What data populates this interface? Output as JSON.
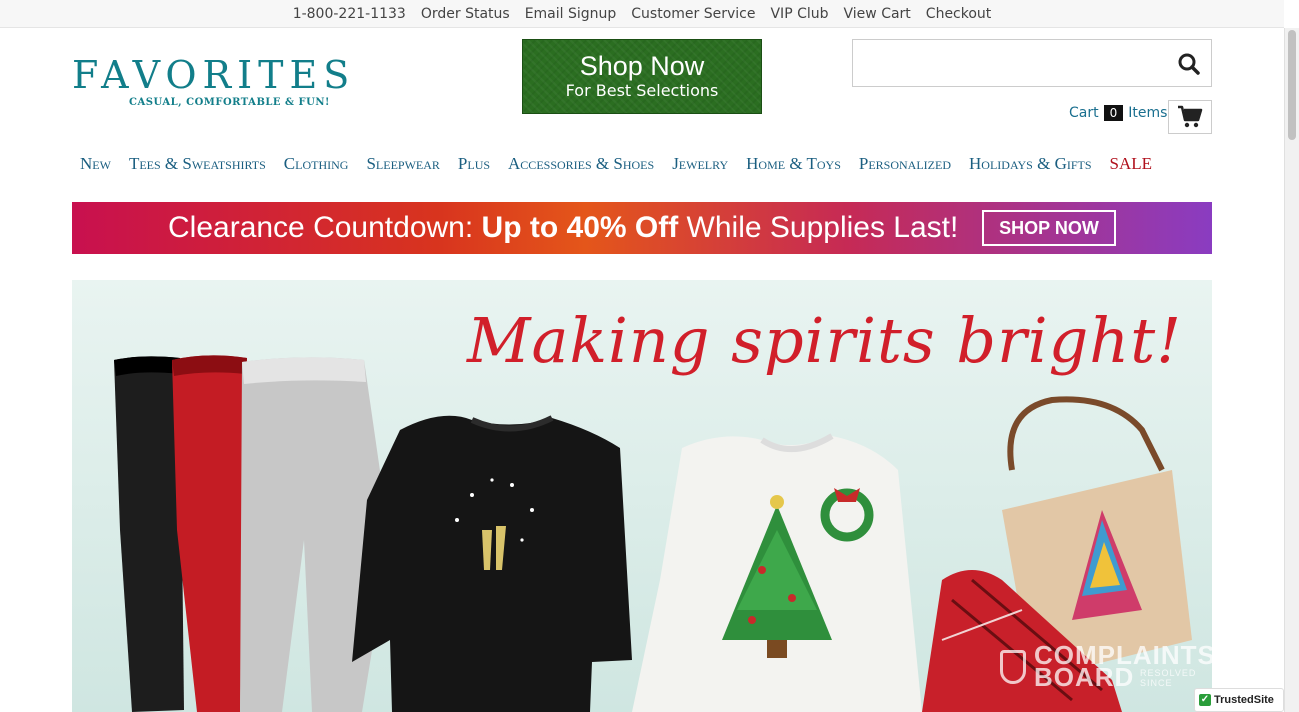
{
  "topbar": {
    "links": [
      "1-800-221-1133",
      "Order Status",
      "Email Signup",
      "Customer Service",
      "VIP Club",
      "View Cart",
      "Checkout"
    ]
  },
  "logo": {
    "word": "FAVORITES",
    "tagline": "CASUAL, COMFORTABLE & FUN!"
  },
  "promo": {
    "headline": "Shop Now",
    "subline": "For Best Selections"
  },
  "search": {
    "value": "",
    "placeholder": ""
  },
  "cart": {
    "label": "Cart",
    "count": "0",
    "items_label": "Items"
  },
  "nav": {
    "items": [
      "New",
      "Tees & Sweatshirts",
      "Clothing",
      "Sleepwear",
      "Plus",
      "Accessories & Shoes",
      "Jewelry",
      "Home & Toys",
      "Personalized",
      "Holidays & Gifts",
      "SALE"
    ]
  },
  "clearance": {
    "text_plain": "Clearance Countdown: ",
    "text_bold": "Up to 40% Off",
    "text_tail": " While Supplies Last!",
    "button": "SHOP NOW"
  },
  "hero": {
    "title": "Making spirits bright!"
  },
  "watermark": {
    "line1": "COMPLAINTS",
    "line2": "BOARD",
    "sub": "RESOLVED SINCE"
  },
  "trusted_badge": {
    "label": "TrustedSite"
  },
  "colors": {
    "brand_teal": "#127e8a",
    "nav_blue": "#1a5e80",
    "sale_red": "#b0101c",
    "promo_green": "#2b6e21"
  }
}
